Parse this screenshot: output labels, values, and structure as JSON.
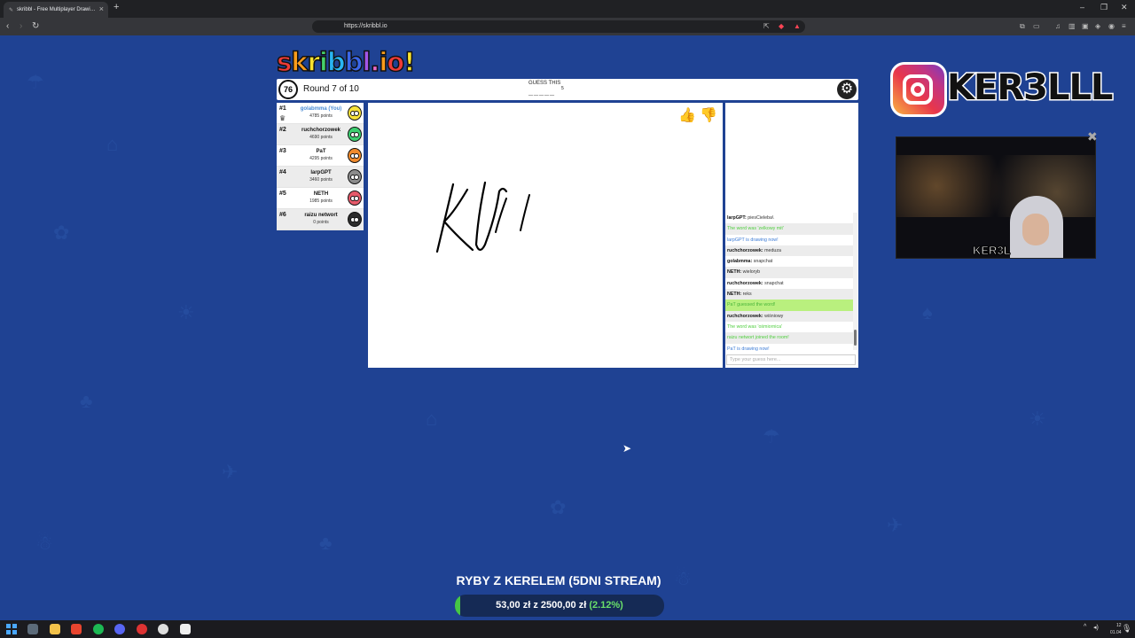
{
  "browser": {
    "tab_title": "skribbl - Free Multiplayer Drawi…",
    "url": "https://skribbl.io"
  },
  "logo": {
    "letters": [
      "s",
      "k",
      "r",
      "i",
      "b",
      "b",
      "l",
      ".",
      "i",
      "o",
      "!"
    ],
    "colors": [
      "#ef3b36",
      "#f99c1b",
      "#fbe32e",
      "#46d16a",
      "#29b5f2",
      "#3b67e8",
      "#a255e8",
      "#e968c9",
      "#f99c1b",
      "#ef3b36",
      "#fbe32e"
    ]
  },
  "game": {
    "timer": "76",
    "round_text": "Round 7 of 10",
    "guess_label": "GUESS THIS",
    "hint": "_____",
    "letter_count": "5"
  },
  "players": [
    {
      "rank": "#1",
      "name": "golabmma (You)",
      "points": "4785 points",
      "you": true,
      "color": "#f7e23b"
    },
    {
      "rank": "#2",
      "name": "ruchchorzowek",
      "points": "4690 points",
      "you": false,
      "color": "#3dcf70"
    },
    {
      "rank": "#3",
      "name": "PaT",
      "points": "4295 points",
      "you": false,
      "color": "#f08a2c"
    },
    {
      "rank": "#4",
      "name": "larpGPT",
      "points": "3460 points",
      "you": false,
      "color": "#8c8c8c"
    },
    {
      "rank": "#5",
      "name": "NETH",
      "points": "1985 points",
      "you": false,
      "color": "#e65a6a"
    },
    {
      "rank": "#6",
      "name": "raizu networt",
      "points": "0 points",
      "you": false,
      "color": "#2c2c2c"
    }
  ],
  "chat": {
    "messages": [
      {
        "user": "larpGPT",
        "text": "piesCieleba\\",
        "type": "normal"
      },
      {
        "user": "",
        "text": "The word was 'zelkowy mit'",
        "type": "green"
      },
      {
        "user": "",
        "text": "larpGPT is drawing now!",
        "type": "blue"
      },
      {
        "user": "ruchchorzowek",
        "text": "meduza",
        "type": "normal"
      },
      {
        "user": "golabmma",
        "text": "snapchat",
        "type": "normal"
      },
      {
        "user": "NETH",
        "text": "wieloryb",
        "type": "normal"
      },
      {
        "user": "ruchchorzowek",
        "text": "snapchat",
        "type": "normal"
      },
      {
        "user": "NETH",
        "text": "reks",
        "type": "normal"
      },
      {
        "user": "",
        "text": "PaT guessed the word!",
        "type": "hl"
      },
      {
        "user": "ruchchorzowek",
        "text": "wiśniowy",
        "type": "normal"
      },
      {
        "user": "",
        "text": "The word was 'ośmiornica'",
        "type": "green"
      },
      {
        "user": "",
        "text": "raizu networt joined the room!",
        "type": "green"
      },
      {
        "user": "",
        "text": "PaT is drawing now!",
        "type": "blue"
      }
    ],
    "input_placeholder": "Type your guess here..."
  },
  "overlay": {
    "instagram_handle": "KER3LLL",
    "cam_label": "KER3L",
    "goal_title": "RYBY Z KERELEM (5DNI STREAM)",
    "goal_current": "53,00 zł",
    "goal_sep": "z",
    "goal_target": "2500,00 zł",
    "goal_percent": "(2.12%)",
    "goal_fraction": 0.0212
  },
  "taskbar": {
    "time": "12",
    "date": "01.04"
  }
}
